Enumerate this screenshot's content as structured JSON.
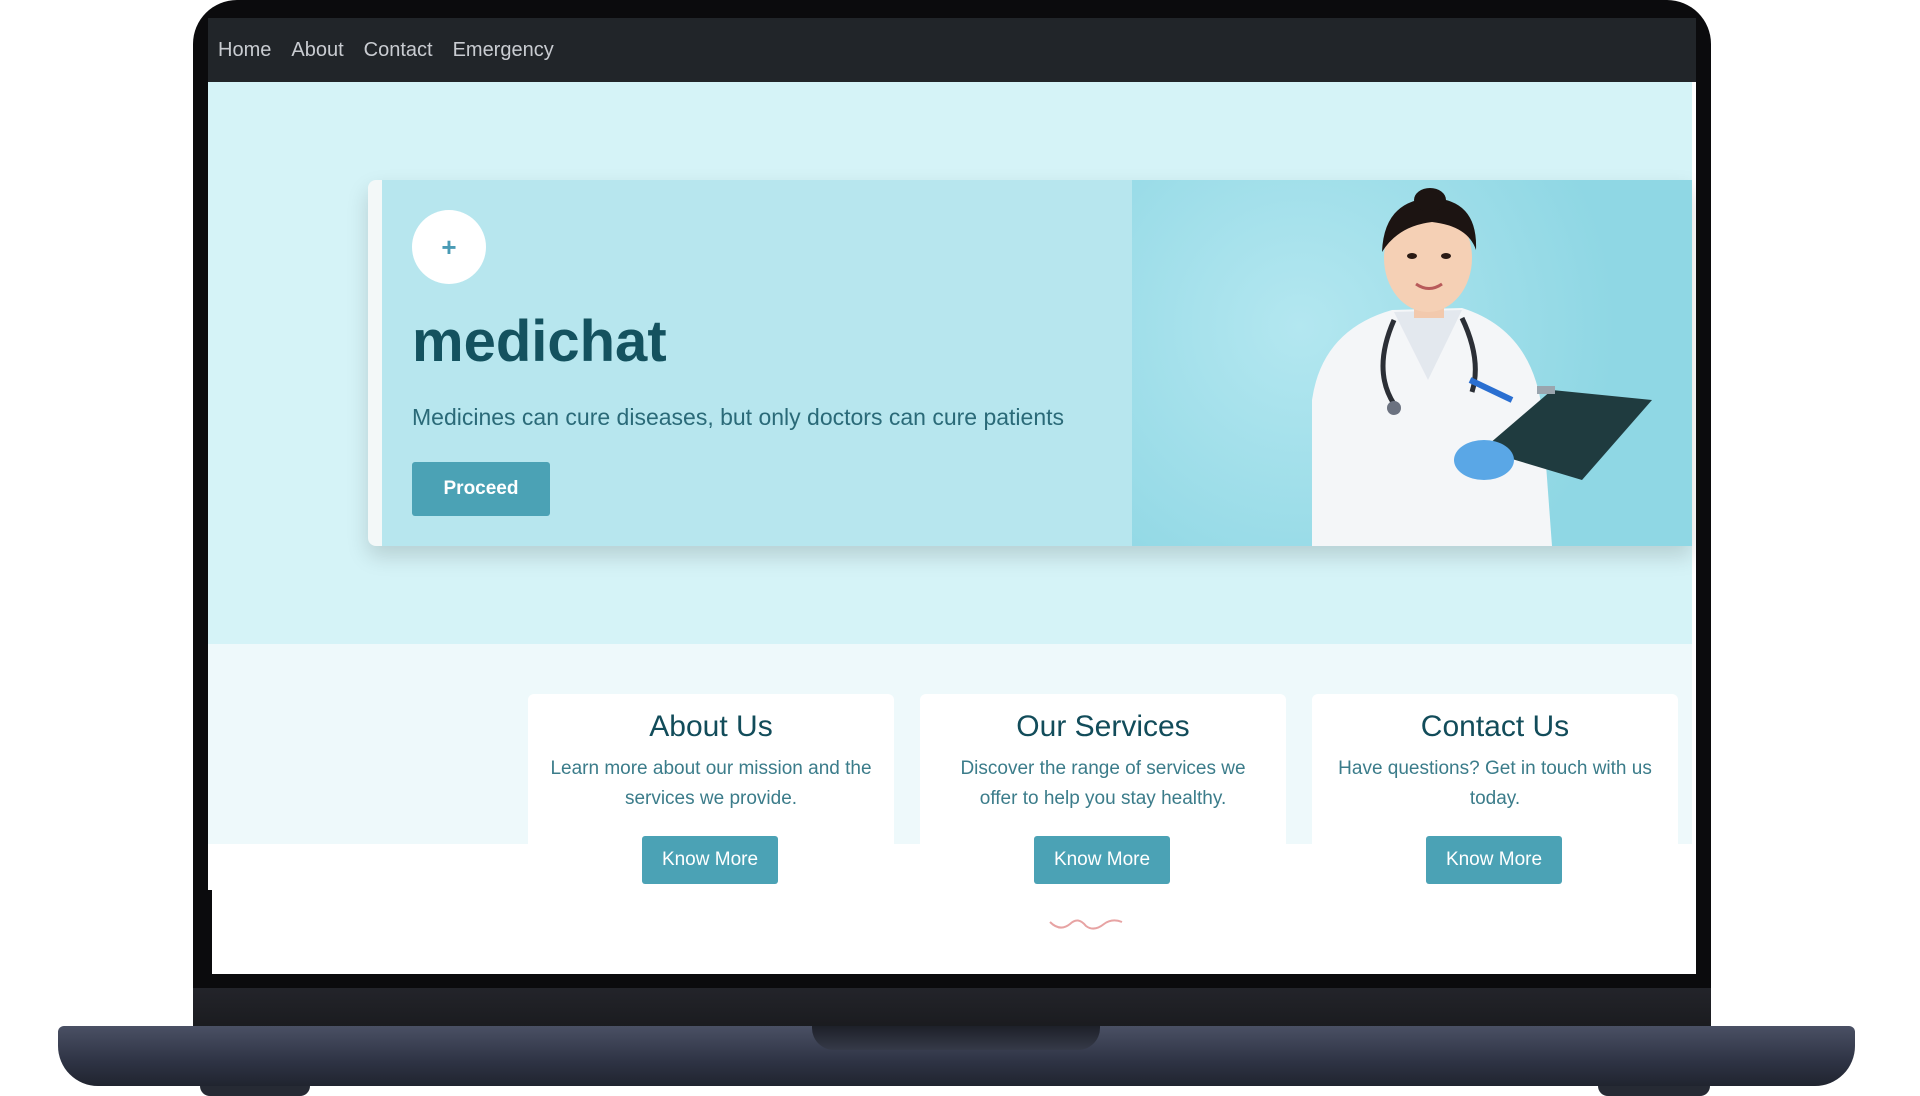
{
  "navbar": {
    "links": [
      "Home",
      "About",
      "Contact",
      "Emergency"
    ]
  },
  "hero": {
    "logo_symbol": "+",
    "title": "medichat",
    "tagline": "Medicines can cure diseases, but only doctors can cure patients",
    "proceed_label": "Proceed",
    "image_description_icon": "doctor-photo"
  },
  "features": [
    {
      "title": "About Us",
      "description": "Learn more about our mission and the services we provide.",
      "button_label": "Know More"
    },
    {
      "title": "Our Services",
      "description": "Discover the range of services we offer to help you stay healthy.",
      "button_label": "Know More"
    },
    {
      "title": "Contact Us",
      "description": "Have questions? Get in touch with us today.",
      "button_label": "Know More"
    }
  ],
  "colors": {
    "navbar_bg": "#212529",
    "hero_bg": "#d5f3f7",
    "accent": "#4ba2b5",
    "title_color": "#14525f"
  }
}
